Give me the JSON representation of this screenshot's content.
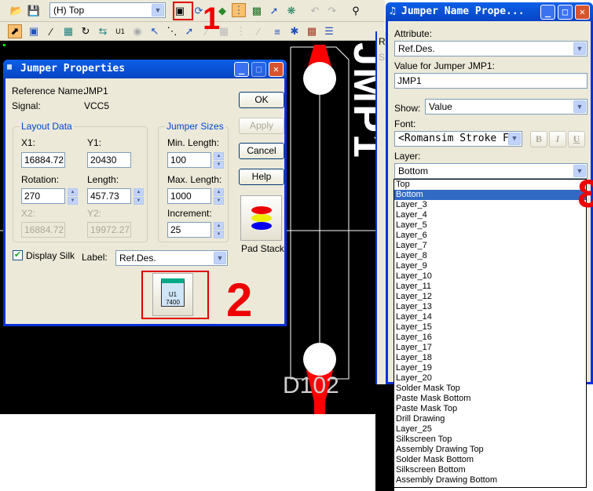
{
  "toolbar": {
    "layer_select": "(H) Top",
    "row1_icons": [
      "open-icon",
      "save-icon",
      "properties-icon",
      "refresh-icon",
      "layer-icon",
      "pads-icon",
      "board-icon",
      "route-icon",
      "cluster-icon",
      "undo-icon",
      "redo-icon",
      "zoom-icon"
    ],
    "row2_icons": [
      "select-icon",
      "select-box-icon",
      "route-icon",
      "move-icon",
      "rotate-icon",
      "swap-icon",
      "label-icon",
      "via-icon",
      "corner-icon",
      "measure-icon",
      "select-nets-icon",
      "unroute-icon",
      "shield-icon",
      "copper-icon",
      "plane-icon",
      "align-icon",
      "net-icon",
      "ecos-icon",
      "list-icon"
    ]
  },
  "annotations": {
    "mark1": "1",
    "mark2": "2",
    "mark3": "3"
  },
  "canvas": {
    "silk_text": "JMP1",
    "ref_text": "D102",
    "colors": {
      "background": "#000000",
      "trace": "#ff0000",
      "pad": "#ffffff"
    }
  },
  "jumper_properties": {
    "title": "Jumper Properties",
    "reference_name_label": "Reference Name:",
    "reference_name": "JMP1",
    "signal_label": "Signal:",
    "signal": "VCC5",
    "layout_data": {
      "title": "Layout Data",
      "x1_label": "X1:",
      "x1": "16884.72",
      "y1_label": "Y1:",
      "y1": "20430",
      "rotation_label": "Rotation:",
      "rotation": "270",
      "length_label": "Length:",
      "length": "457.73",
      "x2_label": "X2:",
      "x2": "16884.72",
      "y2_label": "Y2:",
      "y2": "19972.27"
    },
    "jumper_sizes": {
      "title": "Jumper Sizes",
      "min_label": "Min. Length:",
      "min": "100",
      "max_label": "Max. Length:",
      "max": "1000",
      "inc_label": "Increment:",
      "inc": "25"
    },
    "display_silk_label": "Display Silk",
    "display_silk": true,
    "label_label": "Label:",
    "label_value": "Ref.Des.",
    "ok": "OK",
    "apply": "Apply",
    "cancel": "Cancel",
    "help": "Help",
    "pad_stack": "Pad Stack",
    "label_icon_text": "U1 7400"
  },
  "jumper_name": {
    "title": "Jumper Name Prope...",
    "attribute_label": "Attribute:",
    "attribute": "Ref.Des.",
    "value_label": "Value for Jumper JMP1:",
    "value": "JMP1",
    "show_label": "Show:",
    "show": "Value",
    "font_label": "Font:",
    "font": "<Romansim Stroke F",
    "bold": "B",
    "italic": "I",
    "underline": "U",
    "layer_label": "Layer:",
    "layer": "Bottom",
    "layer_options": [
      "Top",
      "Bottom",
      "Layer_3",
      "Layer_4",
      "Layer_5",
      "Layer_6",
      "Layer_7",
      "Layer_8",
      "Layer_9",
      "Layer_10",
      "Layer_11",
      "Layer_12",
      "Layer_13",
      "Layer_14",
      "Layer_15",
      "Layer_16",
      "Layer_17",
      "Layer_18",
      "Layer_19",
      "Layer_20",
      "Solder Mask Top",
      "Paste Mask Bottom",
      "Paste Mask Top",
      "Drill Drawing",
      "Layer_25",
      "Silkscreen Top",
      "Assembly Drawing Top",
      "Solder Mask Bottom",
      "Silkscreen Bottom",
      "Assembly Drawing Bottom"
    ],
    "selected_index": 1,
    "behind_labels": [
      "R",
      "S"
    ]
  }
}
